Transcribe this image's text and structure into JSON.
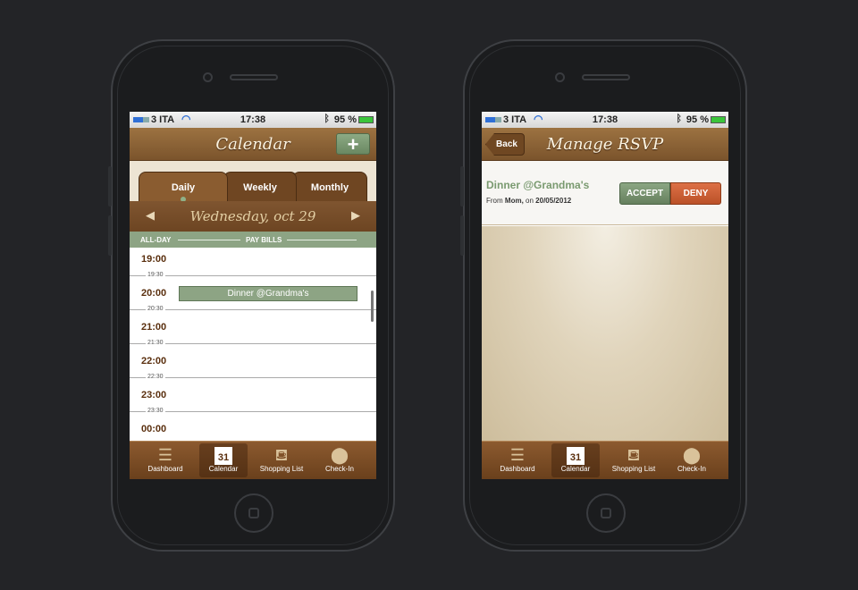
{
  "status": {
    "carrier": "3 ITA",
    "time": "17:38",
    "battery": "95 %"
  },
  "calendar": {
    "title": "Calendar",
    "add_label": "+",
    "tabs": [
      {
        "label": "Daily",
        "active": true
      },
      {
        "label": "Weekly"
      },
      {
        "label": "Monthly"
      }
    ],
    "date": "Wednesday, oct 29",
    "prev": "◀",
    "next": "▶",
    "allday_label": "ALL-DAY",
    "allday_event": "PAY BILLS",
    "hours": [
      {
        "h": "19:00",
        "half": "19:30"
      },
      {
        "h": "20:00",
        "half": "20:30"
      },
      {
        "h": "21:00",
        "half": "21:30"
      },
      {
        "h": "22:00",
        "half": "22:30"
      },
      {
        "h": "23:00",
        "half": "23:30"
      },
      {
        "h": "00:00",
        "half": ""
      }
    ],
    "event": "Dinner @Grandma's"
  },
  "rsvp": {
    "title": "Manage RSVP",
    "back": "Back",
    "event": "Dinner @Grandma's",
    "from_prefix": "From",
    "from": "Mom,",
    "on": "on",
    "date": "20/05/2012",
    "accept": "ACCEPT",
    "deny": "DENY"
  },
  "tabbar": [
    {
      "label": "Dashboard",
      "icon": "list-icon"
    },
    {
      "label": "Calendar",
      "icon": "calendar-icon",
      "day": "31",
      "active": true
    },
    {
      "label": "Shopping List",
      "icon": "basket-icon"
    },
    {
      "label": "Check-In",
      "icon": "pin-icon"
    }
  ],
  "colors": {
    "brown": "#7b542c",
    "green": "#8da484",
    "deny": "#cc5f35"
  }
}
